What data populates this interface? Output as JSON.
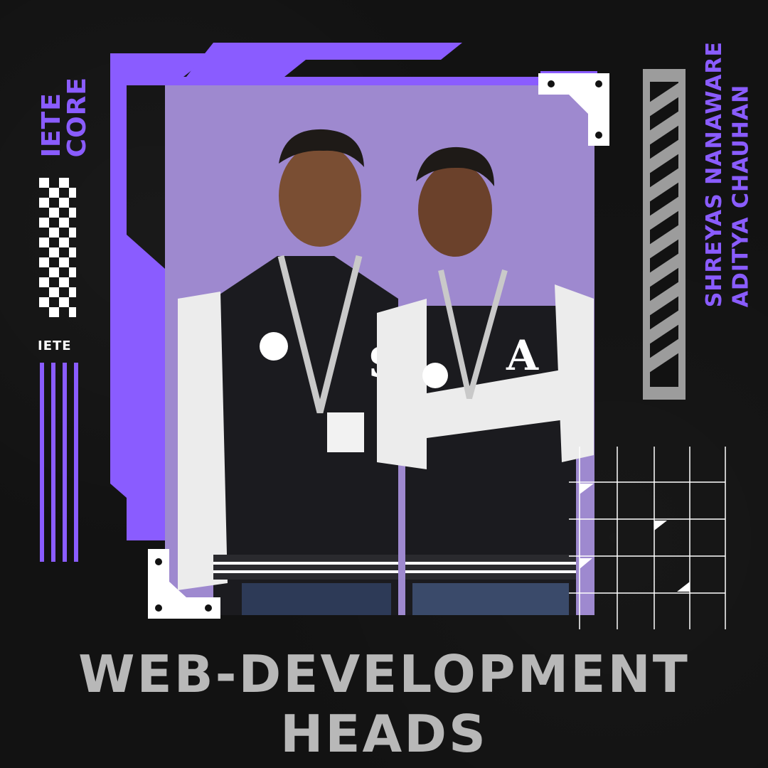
{
  "left_label": {
    "line1": "IETE",
    "line2": "CORE"
  },
  "left_badge": "IETE",
  "names": {
    "first": "SHREYAS NANAWARE",
    "second": "ADITYA CHAUHAN"
  },
  "title": {
    "line1": "WEB-DEVELOPMENT",
    "line2": "HEADS"
  },
  "photo": {
    "description_icon": "person-photo",
    "jacket_letters": [
      "S",
      "A"
    ]
  },
  "colors": {
    "background": "#121212",
    "accent": "#8a5cff",
    "photo_bg": "#9e89cf",
    "text_grey": "#b8b8b8",
    "white": "#ffffff"
  }
}
